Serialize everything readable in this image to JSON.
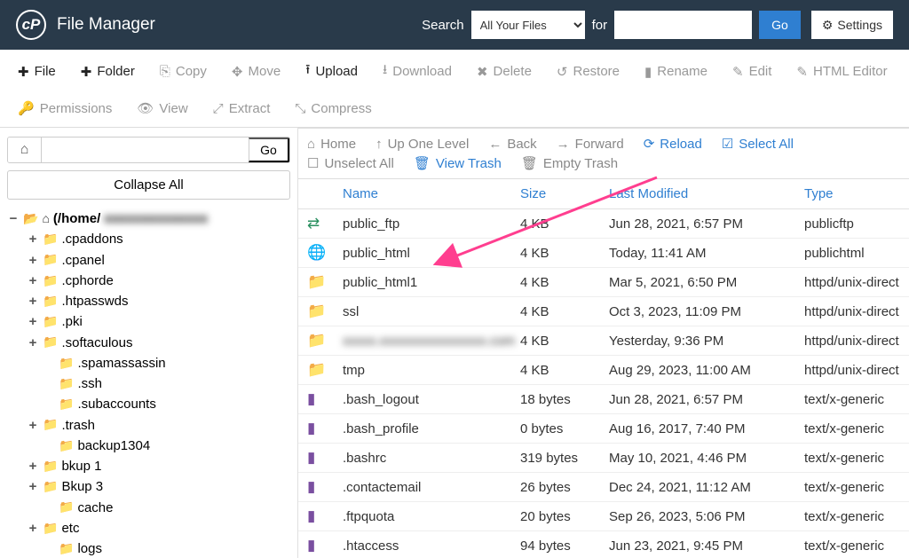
{
  "header": {
    "app_title": "File Manager",
    "search_label": "Search",
    "search_options": [
      "All Your Files"
    ],
    "search_selected": "All Your Files",
    "for_label": "for",
    "search_value": "",
    "go_label": "Go",
    "settings_label": "Settings"
  },
  "toolbar": {
    "file": "File",
    "folder": "Folder",
    "copy": "Copy",
    "move": "Move",
    "upload": "Upload",
    "download": "Download",
    "delete": "Delete",
    "restore": "Restore",
    "rename": "Rename",
    "edit": "Edit",
    "html_editor": "HTML Editor",
    "permissions": "Permissions",
    "view": "View",
    "extract": "Extract",
    "compress": "Compress"
  },
  "left": {
    "go_label": "Go",
    "collapse_label": "Collapse All",
    "root_label": "(/home/",
    "root_censored": "xxxxxxxxxxxxxx",
    "tree": [
      {
        "label": ".cpaddons",
        "expander": "+",
        "indent": 1
      },
      {
        "label": ".cpanel",
        "expander": "+",
        "indent": 1
      },
      {
        "label": ".cphorde",
        "expander": "+",
        "indent": 1
      },
      {
        "label": ".htpasswds",
        "expander": "+",
        "indent": 1
      },
      {
        "label": ".pki",
        "expander": "+",
        "indent": 1
      },
      {
        "label": ".softaculous",
        "expander": "+",
        "indent": 1
      },
      {
        "label": ".spamassassin",
        "expander": "",
        "indent": 2
      },
      {
        "label": ".ssh",
        "expander": "",
        "indent": 2
      },
      {
        "label": ".subaccounts",
        "expander": "",
        "indent": 2
      },
      {
        "label": ".trash",
        "expander": "+",
        "indent": 1
      },
      {
        "label": "backup1304",
        "expander": "",
        "indent": 2
      },
      {
        "label": "bkup 1",
        "expander": "+",
        "indent": 1
      },
      {
        "label": "Bkup 3",
        "expander": "+",
        "indent": 1
      },
      {
        "label": "cache",
        "expander": "",
        "indent": 2
      },
      {
        "label": "etc",
        "expander": "+",
        "indent": 1
      },
      {
        "label": "logs",
        "expander": "",
        "indent": 2
      }
    ]
  },
  "nav": {
    "home": "Home",
    "up": "Up One Level",
    "back": "Back",
    "forward": "Forward",
    "reload": "Reload",
    "select_all": "Select All",
    "unselect_all": "Unselect All",
    "view_trash": "View Trash",
    "empty_trash": "Empty Trash"
  },
  "table": {
    "headers": {
      "name": "Name",
      "size": "Size",
      "last_modified": "Last Modified",
      "type": "Type"
    },
    "rows": [
      {
        "icon": "sync",
        "name": "public_ftp",
        "size": "4 KB",
        "modified": "Jun 28, 2021, 6:57 PM",
        "type": "publicftp"
      },
      {
        "icon": "globe",
        "name": "public_html",
        "size": "4 KB",
        "modified": "Today, 11:41 AM",
        "type": "publichtml"
      },
      {
        "icon": "folder",
        "name": "public_html1",
        "size": "4 KB",
        "modified": "Mar 5, 2021, 6:50 PM",
        "type": "httpd/unix-direct"
      },
      {
        "icon": "folder",
        "name": "ssl",
        "size": "4 KB",
        "modified": "Oct 3, 2023, 11:09 PM",
        "type": "httpd/unix-direct"
      },
      {
        "icon": "folder",
        "name": "xxxxx.xxxxxxxxxxxxxxxx.com",
        "size": "4 KB",
        "modified": "Yesterday, 9:36 PM",
        "type": "httpd/unix-direct",
        "blur": true
      },
      {
        "icon": "folder",
        "name": "tmp",
        "size": "4 KB",
        "modified": "Aug 29, 2023, 11:00 AM",
        "type": "httpd/unix-direct"
      },
      {
        "icon": "file",
        "name": ".bash_logout",
        "size": "18 bytes",
        "modified": "Jun 28, 2021, 6:57 PM",
        "type": "text/x-generic"
      },
      {
        "icon": "file",
        "name": ".bash_profile",
        "size": "0 bytes",
        "modified": "Aug 16, 2017, 7:40 PM",
        "type": "text/x-generic"
      },
      {
        "icon": "file",
        "name": ".bashrc",
        "size": "319 bytes",
        "modified": "May 10, 2021, 4:46 PM",
        "type": "text/x-generic"
      },
      {
        "icon": "file",
        "name": ".contactemail",
        "size": "26 bytes",
        "modified": "Dec 24, 2021, 11:12 AM",
        "type": "text/x-generic"
      },
      {
        "icon": "file",
        "name": ".ftpquota",
        "size": "20 bytes",
        "modified": "Sep 26, 2023, 5:06 PM",
        "type": "text/x-generic"
      },
      {
        "icon": "file",
        "name": ".htaccess",
        "size": "94 bytes",
        "modified": "Jun 23, 2021, 9:45 PM",
        "type": "text/x-generic"
      }
    ]
  }
}
